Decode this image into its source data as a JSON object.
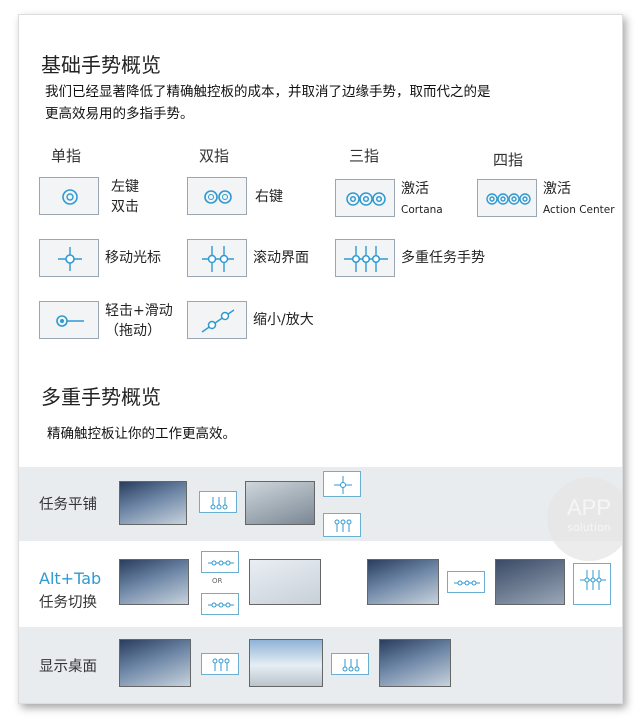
{
  "basic": {
    "title": "基础手势概览",
    "desc_line1": "我们已经显著降低了精确触控板的成本，并取消了边缘手势，取而代之的是",
    "desc_line2": "更高效易用的多指手势。",
    "columns": [
      "单指",
      "双指",
      "三指",
      "四指"
    ],
    "gestures": {
      "one_click": [
        "左键",
        "双击"
      ],
      "one_move": "移动光标",
      "one_tap_slide": [
        "轻击+滑动",
        "（拖动）"
      ],
      "two_right": "右键",
      "two_scroll": "滚动界面",
      "two_zoom": "缩小/放大",
      "three_activate": "激活",
      "three_activate_sub": "Cortana",
      "three_multitask": "多重任务手势",
      "four_activate": "激活",
      "four_activate_sub": "Action Center"
    }
  },
  "multi": {
    "title": "多重手势概览",
    "desc": "精确触控板让你的工作更高效。",
    "rows": [
      {
        "title": "任务平铺"
      },
      {
        "title_en": "Alt+Tab",
        "title": "任务切换",
        "or_label": "OR"
      },
      {
        "title": "显示桌面"
      }
    ]
  },
  "watermark": {
    "line1": "APP",
    "line2": "solution"
  },
  "colors": {
    "accent": "#2f9ad2",
    "band": "#e9ecef",
    "alt_tab": "#2f9ad2"
  }
}
